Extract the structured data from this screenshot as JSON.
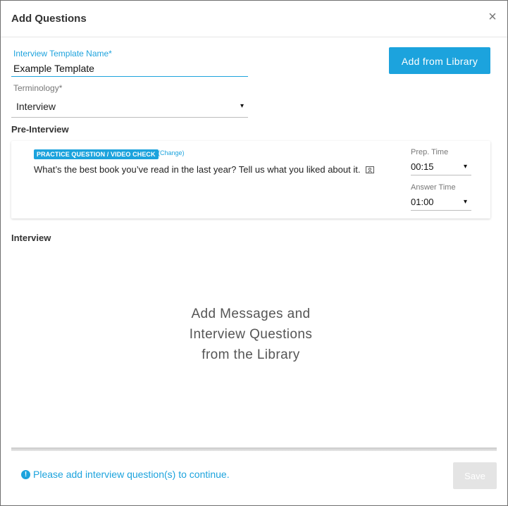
{
  "header": {
    "title": "Add Questions",
    "close_icon": "close-icon",
    "close_glyph": "×"
  },
  "form": {
    "template_name": {
      "label": "Interview Template Name*",
      "value": "Example Template"
    },
    "terminology": {
      "label": "Terminology*",
      "value": "Interview"
    }
  },
  "library_button": {
    "label": "Add from Library"
  },
  "pre_interview": {
    "heading": "Pre-Interview",
    "question": {
      "badge": "PRACTICE QUESTION / VIDEO CHECK",
      "change_label": "(Change)",
      "text": "What’s the best book you’ve read in the last year? Tell us what you liked about it.",
      "edit_icon": "edit-icon",
      "prep_time": {
        "label": "Prep. Time",
        "value": "00:15"
      },
      "answer_time": {
        "label": "Answer Time",
        "value": "01:00"
      }
    }
  },
  "interview": {
    "heading": "Interview",
    "empty_message": "Add Messages and Interview Questions from the Library"
  },
  "footer": {
    "warning_icon": "alert-icon",
    "warning_glyph": "!",
    "warning_text": "Please add interview question(s) to continue.",
    "save_label": "Save"
  },
  "dropdown_caret": "▾",
  "colors": {
    "accent": "#1ca3dd",
    "disabled_button": "#e4e4e4"
  }
}
